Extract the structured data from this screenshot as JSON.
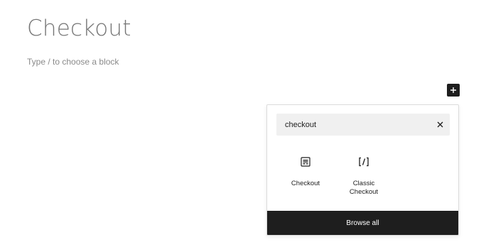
{
  "page": {
    "title": "Checkout",
    "block_placeholder": "Type / to choose a block"
  },
  "inserter": {
    "toggle_icon": "plus-icon",
    "search": {
      "value": "checkout",
      "clear_icon": "close-icon"
    },
    "results": [
      {
        "label": "Checkout",
        "icon": "checkout-block-icon"
      },
      {
        "label": "Classic Checkout",
        "icon": "shortcode-icon"
      }
    ],
    "browse_all_label": "Browse all"
  },
  "colors": {
    "title": "#757575",
    "placeholder": "#8a8a8a",
    "dark": "#1e1e1e",
    "search_bg": "#f0f0f0"
  }
}
